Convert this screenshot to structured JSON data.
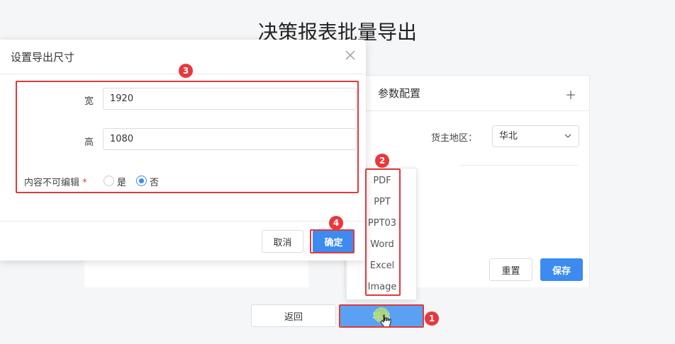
{
  "page": {
    "title": "决策报表批量导出"
  },
  "param_panel": {
    "title": "参数配置",
    "add_icon": "plus-icon",
    "region_label": "货主地区：",
    "region_value": "华北",
    "reset_label": "重置",
    "save_label": "保存"
  },
  "footer": {
    "back_label": "返回",
    "export_label": "导出"
  },
  "export_menu": {
    "items": [
      "PDF",
      "PPT",
      "PPT03",
      "Word",
      "Excel",
      "Image"
    ]
  },
  "modal": {
    "title": "设置导出尺寸",
    "width_label": "宽",
    "width_value": "1920",
    "height_label": "高",
    "height_value": "1080",
    "noneditable_label": "内容不可编辑",
    "required_mark": "*",
    "option_yes": "是",
    "option_no": "否",
    "selected_option": "否",
    "cancel_label": "取消",
    "confirm_label": "确定"
  },
  "annotations": {
    "badges": [
      "1",
      "2",
      "3",
      "4"
    ],
    "highlight_color": "#e0393e"
  },
  "colors": {
    "primary": "#3d8bf0",
    "background": "#f5f6f8"
  }
}
